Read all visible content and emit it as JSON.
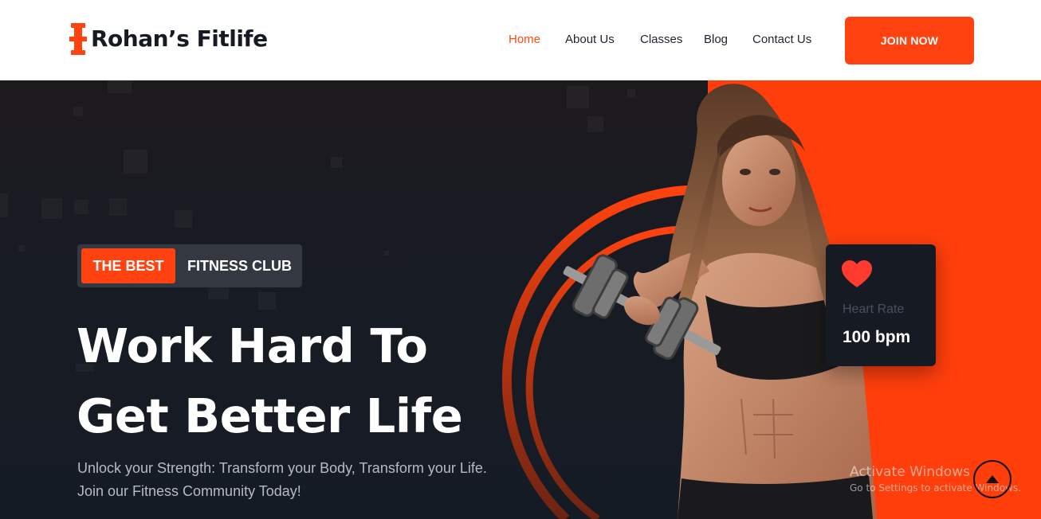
{
  "brand": {
    "name": "Rohan’s Fitlife",
    "accent": "#ff420f",
    "dark": "#151a23"
  },
  "nav": {
    "items": [
      {
        "label": "Home",
        "active": true
      },
      {
        "label": "About Us",
        "active": false
      },
      {
        "label": "Classes",
        "active": false
      },
      {
        "label": "Blog",
        "active": false
      },
      {
        "label": "Contact Us",
        "active": false
      }
    ],
    "cta_label": "JOIN NOW"
  },
  "hero": {
    "badge_highlight": "THE BEST",
    "badge_text": "FITNESS CLUB",
    "headline_line1": "Work Hard To",
    "headline_line2": "Get Better Life",
    "subtext_line1": "Unlock your Strength: Transform your Body, Transform your Life.",
    "subtext_line2": "Join our Fitness Community Today!"
  },
  "heart_rate_card": {
    "icon": "heart-icon",
    "label": "Heart Rate",
    "value": "100 bpm"
  },
  "watermark": {
    "title": "Activate Windows",
    "subtitle": "Go to Settings to activate Windows."
  },
  "scroll_top": {
    "icon": "arrow-up-icon"
  }
}
